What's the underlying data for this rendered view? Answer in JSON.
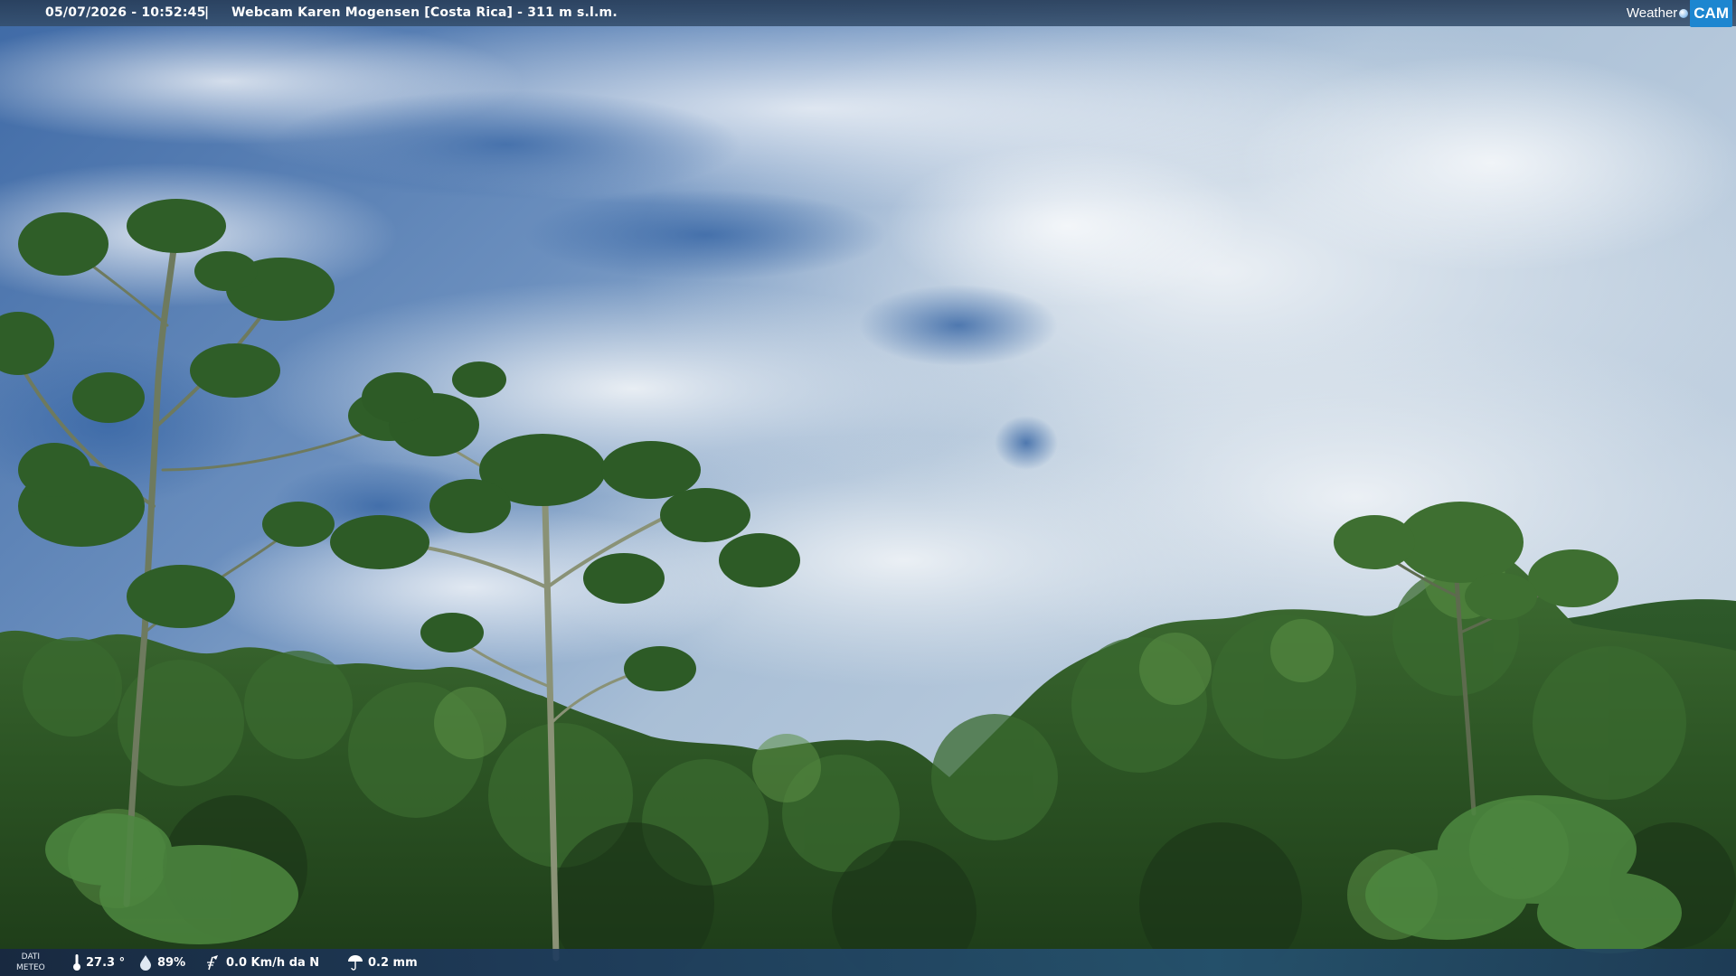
{
  "header": {
    "timestamp": "05/07/2026 - 10:52:45",
    "separator": "|",
    "title": "Webcam Karen Mogensen [Costa Rica] - 311 m s.l.m.",
    "brand_part1": "Weather",
    "brand_part2": "CAM",
    "brand_icon": "globe-icon"
  },
  "weather": {
    "label_line1": "DATI",
    "label_line2": "METEO",
    "temperature": "27.3 °",
    "temperature_icon": "thermometer-icon",
    "humidity": "89%",
    "humidity_icon": "droplet-icon",
    "wind": "0.0 Km/h da N",
    "wind_icon": "wind-icon",
    "rain": "0.2 mm",
    "rain_icon": "umbrella-icon"
  },
  "colors": {
    "brand_blue": "#1d86d0",
    "bar_background": "#2b4a6c",
    "sky_blue": "#3d6aa6",
    "cloud_white": "#dfe7ee",
    "foliage_green": "#2f5a26"
  }
}
